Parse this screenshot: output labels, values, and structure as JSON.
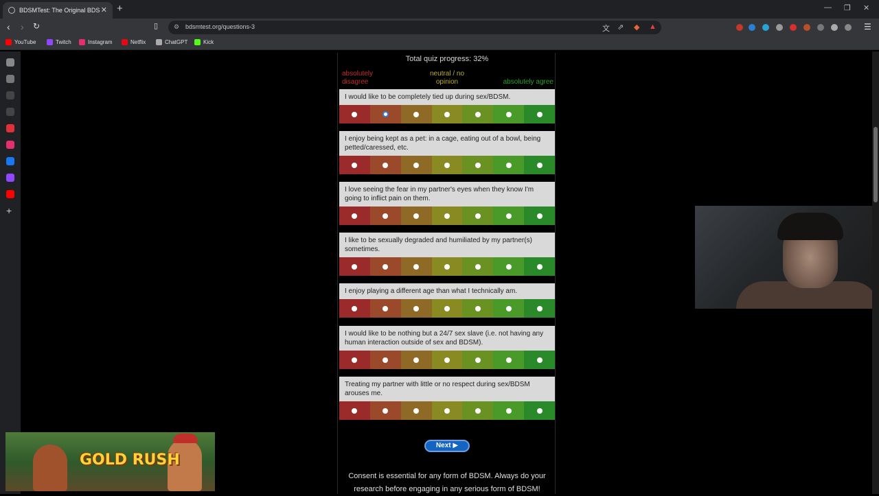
{
  "browser": {
    "tab_title": "BDSMTest: The Original BDSM &",
    "url": "bdsmtest.org/questions-3",
    "bookmarks": [
      {
        "label": "YouTube",
        "color": "#ff0000"
      },
      {
        "label": "Twitch",
        "color": "#9146ff"
      },
      {
        "label": "Instagram",
        "color": "#e1306c"
      },
      {
        "label": "Netflix",
        "color": "#e50914"
      },
      {
        "label": "ChatGPT",
        "color": "#aaaaaa"
      },
      {
        "label": "Kick",
        "color": "#53fc18"
      }
    ]
  },
  "quiz": {
    "progress": "Total quiz progress: 32%",
    "scale": {
      "left": "absolutely disagree",
      "middle": "neutral / no opinion",
      "right": "absolutely agree"
    },
    "option_colors": [
      "#9b2a2a",
      "#9a4a2a",
      "#8f6a26",
      "#8a8a22",
      "#6a9222",
      "#4a9a2a",
      "#2a8a2a"
    ],
    "questions": [
      {
        "text": "I would like to be completely tied up during sex/BDSM.",
        "selected": 1
      },
      {
        "text": "I enjoy being kept as a pet: in a cage, eating out of a bowl, being petted/caressed, etc.",
        "selected": null
      },
      {
        "text": "I love seeing the fear in my partner's eyes when they know I'm going to inflict pain on them.",
        "selected": null
      },
      {
        "text": "I like to be sexually degraded and humiliated by my partner(s) sometimes.",
        "selected": null
      },
      {
        "text": "I enjoy playing a different age than what I technically am.",
        "selected": null
      },
      {
        "text": "I would like to be nothing but a 24/7 sex slave (i.e. not having any human interaction outside of sex and BDSM).",
        "selected": null
      },
      {
        "text": "Treating my partner with little or no respect during sex/BDSM arouses me.",
        "selected": null
      }
    ],
    "next_label": "Next ▶",
    "consent": "Consent is essential for any form of BDSM. Always do your research before engaging in any serious form of BDSM!"
  },
  "game_ad": {
    "title": "GOLD RUSH"
  }
}
